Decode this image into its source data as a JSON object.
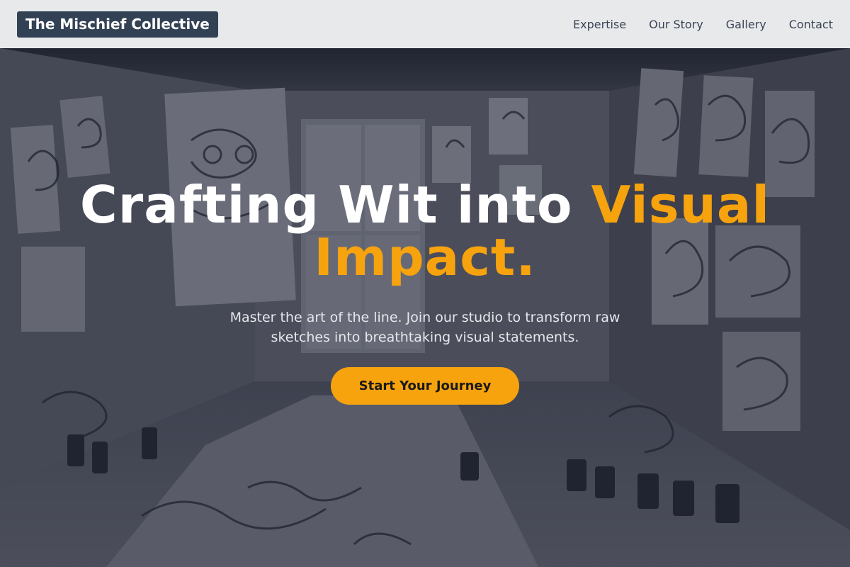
{
  "nav": {
    "brand": "The Mischief Collective",
    "links": [
      "Expertise",
      "Our Story",
      "Gallery",
      "Contact"
    ]
  },
  "hero": {
    "headline_white": "Crafting Wit into ",
    "headline_accent": "Visual Impact.",
    "subtitle": "Master the art of the line. Join our studio to transform raw sketches into breathtaking visual statements.",
    "cta_label": "Start Your Journey"
  },
  "colors": {
    "accent": "#f7a30e",
    "brand_bg": "#334155",
    "nav_bg": "#e8e9eb"
  }
}
